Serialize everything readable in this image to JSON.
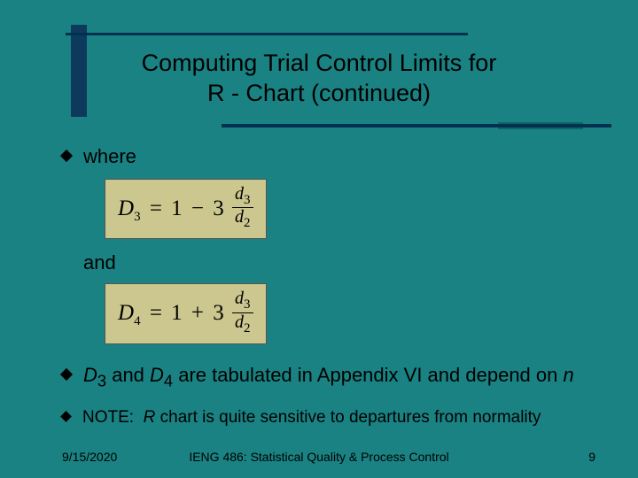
{
  "title": {
    "line1": "Computing Trial Control Limits for",
    "line2": "R - Chart (continued)"
  },
  "bullets": {
    "where": "where",
    "and": "and",
    "tabulated_pre": "D",
    "tabulated_mid1": " and ",
    "tabulated_mid2": " are tabulated in Appendix VI and depend on ",
    "note": "NOTE:  R chart is quite sensitive to departures from normality"
  },
  "formulas": {
    "d3_label": "D",
    "d3_sub": "3",
    "d4_label": "D",
    "d4_sub": "4",
    "eq": "=",
    "one": "1",
    "minus": "−",
    "plus": "+",
    "three": "3",
    "frac_num_var": "d",
    "frac_num_sub": "3",
    "frac_den_var": "d",
    "frac_den_sub": "2",
    "n_var": "n"
  },
  "footer": {
    "date": "9/15/2020",
    "course": "IENG 486:  Statistical Quality & Process Control",
    "page": "9"
  }
}
